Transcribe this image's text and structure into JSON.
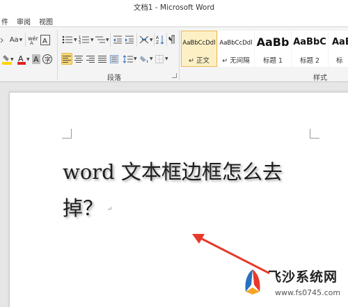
{
  "window": {
    "title": "文档1 - Microsoft Word"
  },
  "menu": {
    "tabs": [
      "件",
      "审阅",
      "视图"
    ]
  },
  "ribbon": {
    "font_size_label": "Aa",
    "paragraph_group_label": "段落",
    "styles_group_label": "样式",
    "styles": [
      {
        "sample": "AaBbCcDdl",
        "name": "↵ 正文",
        "selected": true
      },
      {
        "sample": "AaBbCcDdl",
        "name": "↵ 无间隔",
        "selected": false
      },
      {
        "sample": "AaBb",
        "name": "标题 1",
        "selected": false
      },
      {
        "sample": "AaBbC",
        "name": "标题 2",
        "selected": false
      },
      {
        "sample": "AaBb",
        "name": "标",
        "selected": false
      }
    ]
  },
  "document": {
    "line1": "word 文本框边框怎么去",
    "line2": "掉？",
    "paragraph_mark": "↵"
  },
  "watermark": {
    "name": "飞沙系统网",
    "url": "www.fs0745.com"
  },
  "colors": {
    "annotation_arrow": "#e8392b",
    "highlight": "#ffd400",
    "font_color": "#e02020",
    "accent": "#fbd873"
  }
}
